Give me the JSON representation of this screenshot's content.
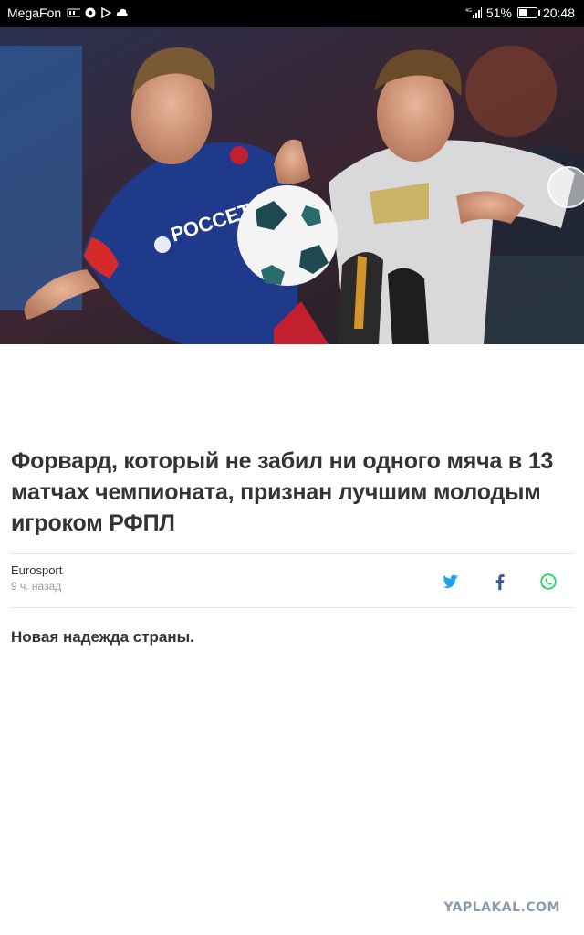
{
  "status_bar": {
    "carrier": "MegaFon",
    "battery_percent": "51%",
    "battery_level": 0.51,
    "time": "20:48",
    "icons": [
      "volte-icon",
      "vpn-icon",
      "play-store-icon",
      "cloud-icon",
      "signal-icon",
      "battery-icon"
    ]
  },
  "hero": {
    "kit_sponsor": "РОССЕТИ"
  },
  "article": {
    "headline": "Форвард, который не забил ни одного мяча в 13 матчах чемпионата, признан лучшим молодым игроком РФПЛ",
    "source": "Eurosport",
    "time_ago": "9 ч. назад",
    "share": [
      {
        "name": "twitter",
        "icon": "twitter-icon",
        "color": "#1da1f2"
      },
      {
        "name": "facebook",
        "icon": "facebook-icon",
        "color": "#3b5998"
      },
      {
        "name": "whatsapp",
        "icon": "whatsapp-icon",
        "color": "#25d366"
      }
    ],
    "lead": "Новая надежда страны."
  },
  "watermark": "YAPLAKAL.COM",
  "colors": {
    "headline": "#333333",
    "muted": "#9a9a9a"
  }
}
